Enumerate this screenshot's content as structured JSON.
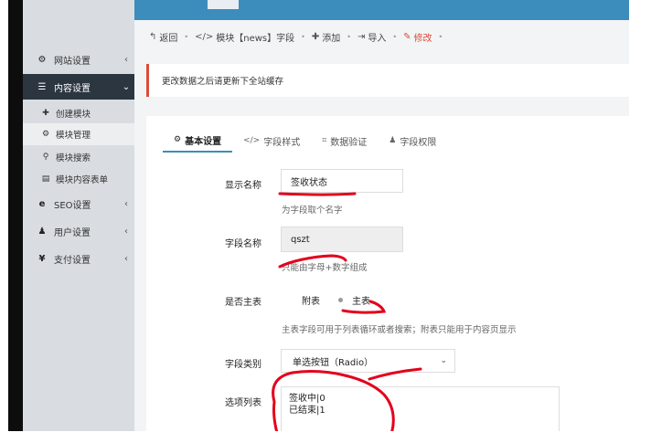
{
  "sidebar": {
    "items": [
      {
        "label": "网站设置",
        "icon": "gear-icon",
        "glyph": "⚙",
        "arrow": "‹"
      },
      {
        "label": "内容设置",
        "icon": "list-icon",
        "glyph": "☰",
        "arrow": "⌄"
      },
      {
        "label": "SEO设置",
        "icon": "edge-icon",
        "glyph": "e",
        "arrow": "‹"
      },
      {
        "label": "用户设置",
        "icon": "user-icon",
        "glyph": "♟",
        "arrow": "‹"
      },
      {
        "label": "支付设置",
        "icon": "yen-icon",
        "glyph": "¥",
        "arrow": "‹"
      }
    ],
    "subitems": [
      {
        "label": "创建模块",
        "icon": "plus-icon",
        "glyph": "✚"
      },
      {
        "label": "模块管理",
        "icon": "cogs-icon",
        "glyph": "⚙"
      },
      {
        "label": "模块搜索",
        "icon": "search-icon",
        "glyph": "⚲"
      },
      {
        "label": "模块内容表单",
        "icon": "table-icon",
        "glyph": "▤"
      }
    ]
  },
  "breadcrumb": {
    "back": "返回",
    "module": "模块【news】字段",
    "add": "添加",
    "import": "导入",
    "edit": "修改"
  },
  "alert": {
    "text": "更改数据之后请更新下全站缓存"
  },
  "tabs": [
    {
      "label": "基本设置",
      "icon": "cog-icon",
      "glyph": "⚙"
    },
    {
      "label": "字段样式",
      "icon": "code-icon",
      "glyph": "</>"
    },
    {
      "label": "数据验证",
      "icon": "crop-icon",
      "glyph": "⌗"
    },
    {
      "label": "字段权限",
      "icon": "user-icon",
      "glyph": "♟"
    }
  ],
  "form": {
    "display_name_label": "显示名称",
    "display_name_value": "签收状态",
    "display_name_help": "为字段取个名字",
    "field_name_label": "字段名称",
    "field_name_value": "qszt",
    "field_name_help": "只能由字母+数字组成",
    "is_main_label": "是否主表",
    "option_sub": "附表",
    "option_main": "主表",
    "is_main_help": "主表字段可用于列表循环或者搜索；附表只能用于内容页显示",
    "field_type_label": "字段类别",
    "field_type_value": "单选按钮（Radio）",
    "options_label": "选项列表",
    "options_lines": [
      "签收中|0",
      "已结束|1"
    ]
  },
  "colors": {
    "accent": "#3c8dbc",
    "alert": "#dd4b39",
    "sidebar_active": "#2c3641",
    "annotation": "#e3001b"
  }
}
